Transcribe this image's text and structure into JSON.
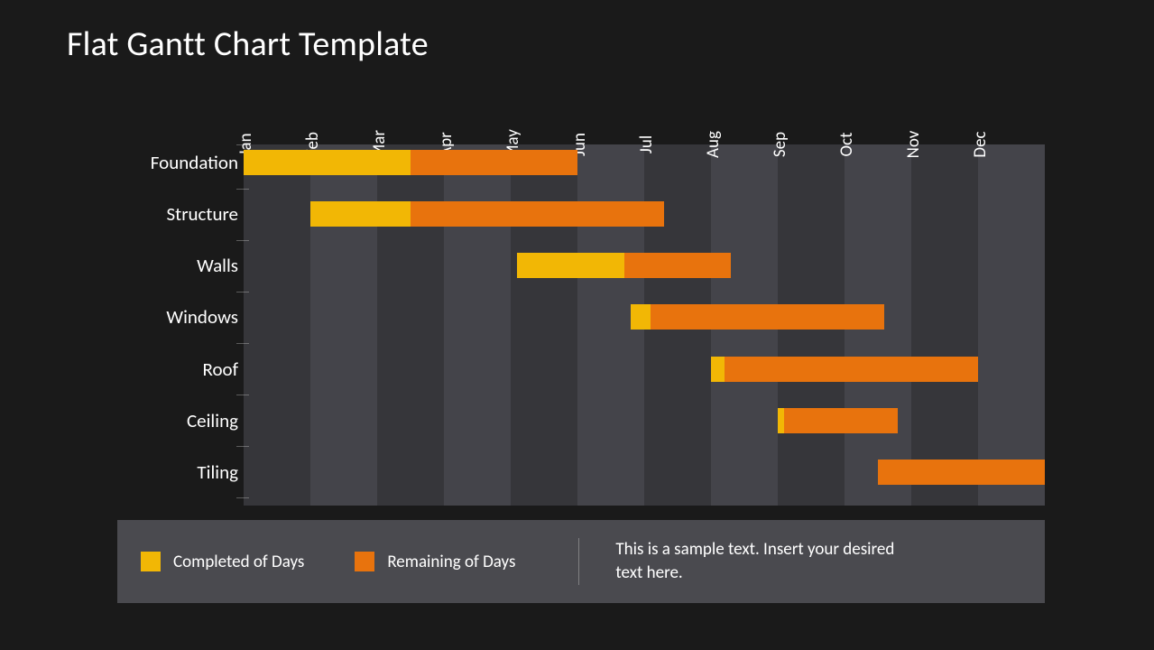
{
  "title": "Flat Gantt Chart Template",
  "legend": {
    "completed": "Completed of Days",
    "remaining": "Remaining of Days"
  },
  "note": "This is a sample text. Insert your desired text here.",
  "colors": {
    "completed": "#f2b705",
    "remaining": "#e8730d",
    "col_dark": "#36363a",
    "col_light": "#44444a"
  },
  "chart_data": {
    "type": "bar",
    "orientation": "gantt",
    "title": "Flat Gantt Chart Template",
    "x_categories": [
      "Jan",
      "Feb",
      "Mar",
      "Apr",
      "May",
      "Jun",
      "Jul",
      "Aug",
      "Sep",
      "Oct",
      "Nov",
      "Dec"
    ],
    "xlim_months": [
      0,
      12
    ],
    "tasks": [
      "Foundation",
      "Structure",
      "Walls",
      "Windows",
      "Roof",
      "Ceiling",
      "Tiling"
    ],
    "series": [
      {
        "name": "Completed of Days",
        "role": "done"
      },
      {
        "name": "Remaining of Days",
        "role": "remaining"
      }
    ],
    "bars": [
      {
        "task": "Foundation",
        "start_month": 0.0,
        "completed_months": 2.5,
        "remaining_months": 2.5,
        "total_months": 5.0
      },
      {
        "task": "Structure",
        "start_month": 1.0,
        "completed_months": 1.5,
        "remaining_months": 3.8,
        "total_months": 5.3
      },
      {
        "task": "Walls",
        "start_month": 4.1,
        "completed_months": 1.6,
        "remaining_months": 1.6,
        "total_months": 3.2
      },
      {
        "task": "Windows",
        "start_month": 5.8,
        "completed_months": 0.3,
        "remaining_months": 3.5,
        "total_months": 3.8
      },
      {
        "task": "Roof",
        "start_month": 7.0,
        "completed_months": 0.2,
        "remaining_months": 3.8,
        "total_months": 4.0
      },
      {
        "task": "Ceiling",
        "start_month": 8.0,
        "completed_months": 0.1,
        "remaining_months": 1.7,
        "total_months": 1.8
      },
      {
        "task": "Tiling",
        "start_month": 9.5,
        "completed_months": 0.0,
        "remaining_months": 2.5,
        "total_months": 2.5
      }
    ]
  }
}
